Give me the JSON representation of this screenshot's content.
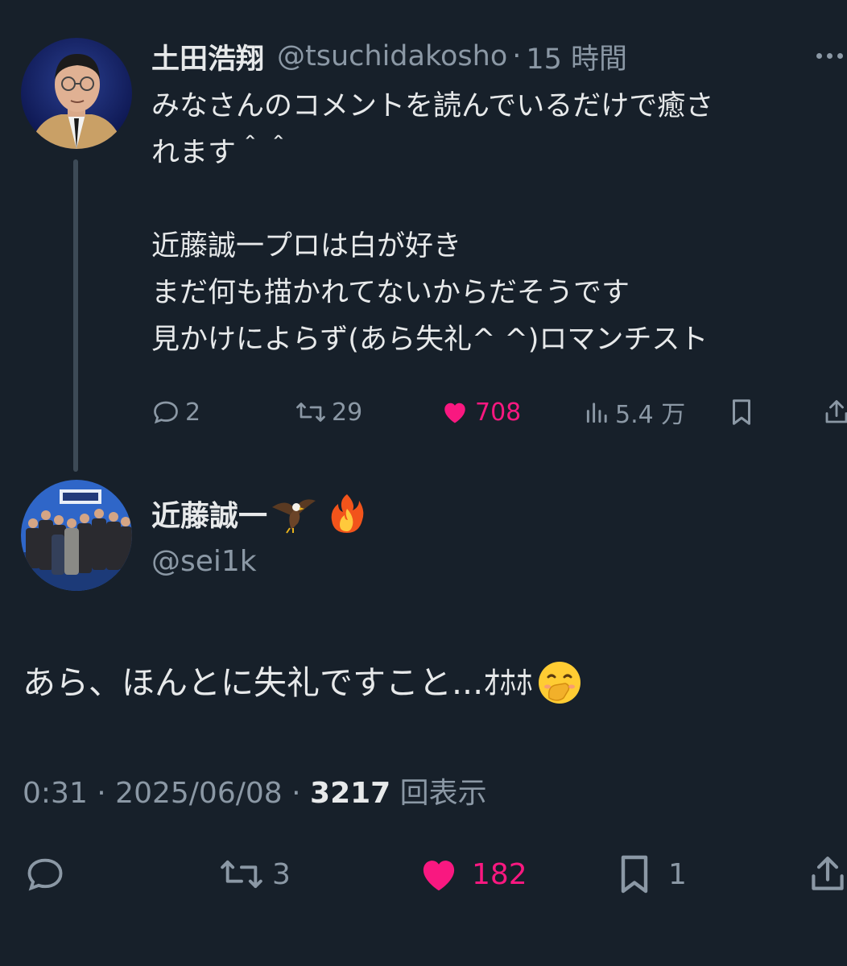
{
  "parent": {
    "display_name": "土田浩翔",
    "handle": "@tsuchidakosho",
    "separator": "·",
    "time": "15 時間",
    "body_lines": [
      "みなさんのコメントを読んでいるだけで癒さ",
      "れます＾＾",
      "",
      "近藤誠一プロは白が好き",
      "まだ何も描かれてないからだそうです",
      "見かけによらず(あら失礼^ ^)ロマンチスト"
    ],
    "actions": {
      "replies": "2",
      "retweets": "29",
      "likes": "708",
      "views": "5.4 万"
    }
  },
  "main": {
    "display_name": "近藤誠一",
    "handle": "@sei1k",
    "body": "あら、ほんとに失礼ですこと...ｵﾎﾎ",
    "timestamp": "0:31 · 2025/06/08 ·",
    "views_count": "3217",
    "views_label": "回表示",
    "actions": {
      "retweets": "3",
      "likes": "182",
      "bookmarks": "1"
    }
  },
  "colors": {
    "background": "#17202a",
    "text": "#e7e9ea",
    "muted": "#8b98a5",
    "like": "#f91880"
  },
  "icons": [
    "reply-icon",
    "retweet-icon",
    "heart-icon",
    "views-icon",
    "bookmark-icon",
    "share-icon",
    "more-icon",
    "eagle-emoji-icon",
    "fire-emoji-icon",
    "hand-over-mouth-emoji-icon"
  ]
}
